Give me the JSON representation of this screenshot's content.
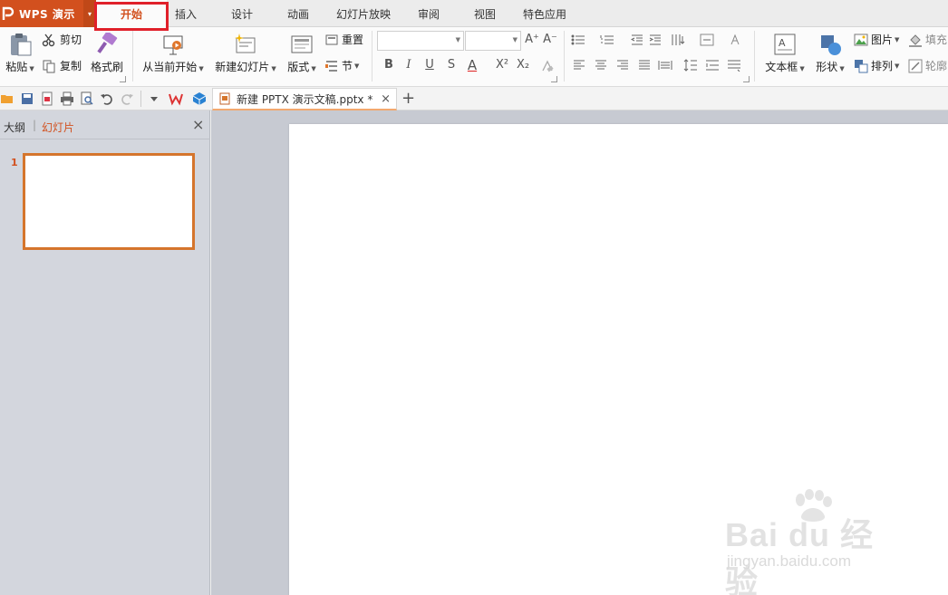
{
  "app": {
    "name": "WPS 演示",
    "drop_arrow": "▾"
  },
  "tabs": [
    {
      "label": "开始"
    },
    {
      "label": "插入"
    },
    {
      "label": "设计"
    },
    {
      "label": "动画"
    },
    {
      "label": "幻灯片放映"
    },
    {
      "label": "审阅"
    },
    {
      "label": "视图"
    },
    {
      "label": "特色应用"
    }
  ],
  "ribbon": {
    "paste": "粘贴",
    "cut": "剪切",
    "copy": "复制",
    "format_painter": "格式刷",
    "from_current": "从当前开始",
    "new_slide": "新建幻灯片",
    "layout": "版式",
    "reset": "重置",
    "section": "节",
    "font_name": "",
    "font_size": "",
    "bold": "B",
    "italic": "I",
    "underline": "U",
    "shadow": "S",
    "font_color": "A",
    "superscript": "X²",
    "subscript": "X₂",
    "grow": "A⁺",
    "shrink": "A⁻",
    "textbox": "文本框",
    "shapes": "形状",
    "picture": "图片",
    "arrange": "排列",
    "fill": "填充",
    "outline": "轮廓"
  },
  "document": {
    "tab_title": "新建 PPTX 演示文稿.pptx *",
    "close": "×",
    "new_tab": "+"
  },
  "panel": {
    "outline_tab": "大纲",
    "divider": "|",
    "slides_tab": "幻灯片",
    "close": "×",
    "slide_number": "1"
  },
  "watermark": {
    "brand": "Bai du 经验",
    "url": "jingyan.baidu.com"
  },
  "colors": {
    "accent": "#d2501e",
    "highlight": "#e0202a",
    "thumb_border": "#d5752c"
  }
}
